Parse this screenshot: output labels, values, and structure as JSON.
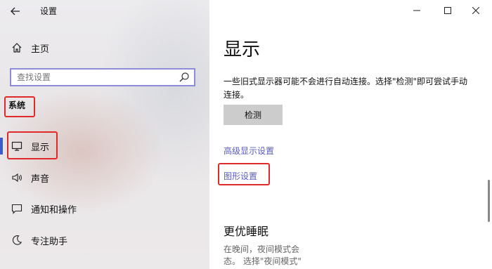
{
  "window": {
    "title": "设置",
    "controls": {
      "minimize_icon": "minimize-icon",
      "maximize_icon": "maximize-icon",
      "close_icon": "close-icon"
    }
  },
  "sidebar": {
    "back_icon": "back-arrow-icon",
    "home": {
      "label": "主页",
      "icon": "home-icon"
    },
    "search": {
      "placeholder": "查找设置",
      "value": "",
      "icon": "search-icon"
    },
    "section_label": "系统",
    "items": [
      {
        "label": "显示",
        "icon": "monitor-icon",
        "selected": true
      },
      {
        "label": "声音",
        "icon": "speaker-icon",
        "selected": false
      },
      {
        "label": "通知和操作",
        "icon": "notification-icon",
        "selected": false
      },
      {
        "label": "专注助手",
        "icon": "moon-icon",
        "selected": false
      }
    ]
  },
  "main": {
    "title": "显示",
    "description": "一些旧式显示器可能不会进行自动连接。选择\"检测\"即可尝试手动连接。",
    "detect_button": "检测",
    "advanced_link": "高级显示设置",
    "graphics_link": "图形设置",
    "sleep_section": {
      "title": "更优睡眠",
      "desc_line1": "在晚间，夜间模式会",
      "desc_line2": "态。 选择\"夜间模式\""
    }
  },
  "colors": {
    "accent": "#3b5cc4",
    "link": "#5b5fb4",
    "highlight_box": "#e02a2a",
    "button_bg": "#cccccc"
  }
}
